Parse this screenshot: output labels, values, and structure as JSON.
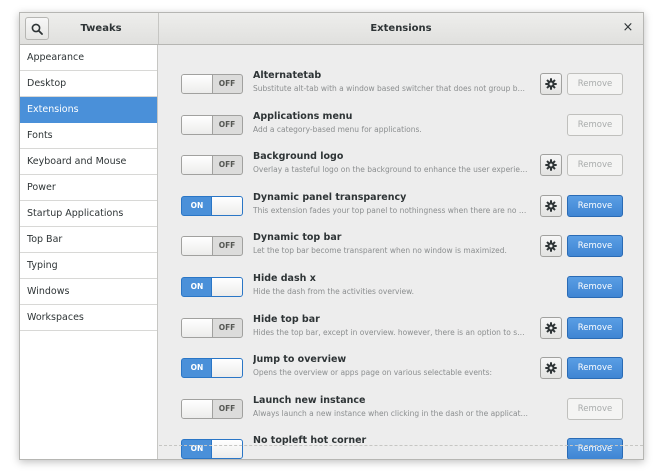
{
  "header": {
    "left_title": "Tweaks",
    "main_title": "Extensions",
    "close_glyph": "×",
    "search_icon": "search-icon",
    "close_icon": "close-icon"
  },
  "sidebar": {
    "active_color": "#4a90d9",
    "items": [
      {
        "label": "Appearance",
        "active": false
      },
      {
        "label": "Desktop",
        "active": false
      },
      {
        "label": "Extensions",
        "active": true
      },
      {
        "label": "Fonts",
        "active": false
      },
      {
        "label": "Keyboard and Mouse",
        "active": false
      },
      {
        "label": "Power",
        "active": false
      },
      {
        "label": "Startup Applications",
        "active": false
      },
      {
        "label": "Top Bar",
        "active": false
      },
      {
        "label": "Typing",
        "active": false
      },
      {
        "label": "Windows",
        "active": false
      },
      {
        "label": "Workspaces",
        "active": false
      }
    ]
  },
  "extensions": [
    {
      "name": "Alternatetab",
      "description": "Substitute alt-tab with a window based switcher that does not group by application.",
      "state": "OFF",
      "has_settings": true,
      "remove_enabled": false
    },
    {
      "name": "Applications menu",
      "description": "Add a category-based menu for applications.",
      "state": "OFF",
      "has_settings": false,
      "remove_enabled": false
    },
    {
      "name": "Background logo",
      "description": "Overlay a tasteful logo on the background to enhance the user experience",
      "state": "OFF",
      "has_settings": true,
      "remove_enabled": false
    },
    {
      "name": "Dynamic panel transparency",
      "description": "This extension fades your top panel to nothingness when there are no maximized windows",
      "state": "ON",
      "has_settings": true,
      "remove_enabled": true
    },
    {
      "name": "Dynamic top bar",
      "description": "Let the top bar become transparent when no window is maximized.",
      "state": "OFF",
      "has_settings": true,
      "remove_enabled": true
    },
    {
      "name": "Hide dash x",
      "description": "Hide the dash from the activities overview.",
      "state": "ON",
      "has_settings": false,
      "remove_enabled": true
    },
    {
      "name": "Hide top bar",
      "description": "Hides the top bar, except in overview. however, there is an option to show the panel",
      "state": "OFF",
      "has_settings": true,
      "remove_enabled": true
    },
    {
      "name": "Jump to overview",
      "description": "Opens the overview or apps page on various selectable events:",
      "state": "ON",
      "has_settings": true,
      "remove_enabled": true
    },
    {
      "name": "Launch new instance",
      "description": "Always launch a new instance when clicking in the dash or the application view.",
      "state": "OFF",
      "has_settings": false,
      "remove_enabled": false
    },
    {
      "name": "No topleft hot corner",
      "description": "",
      "state": "ON",
      "has_settings": false,
      "remove_enabled": true
    }
  ],
  "remove_label": "Remove",
  "colors": {
    "accent": "#4a90d9",
    "background": "#ededed",
    "desc_text": "#8b8e8f"
  }
}
